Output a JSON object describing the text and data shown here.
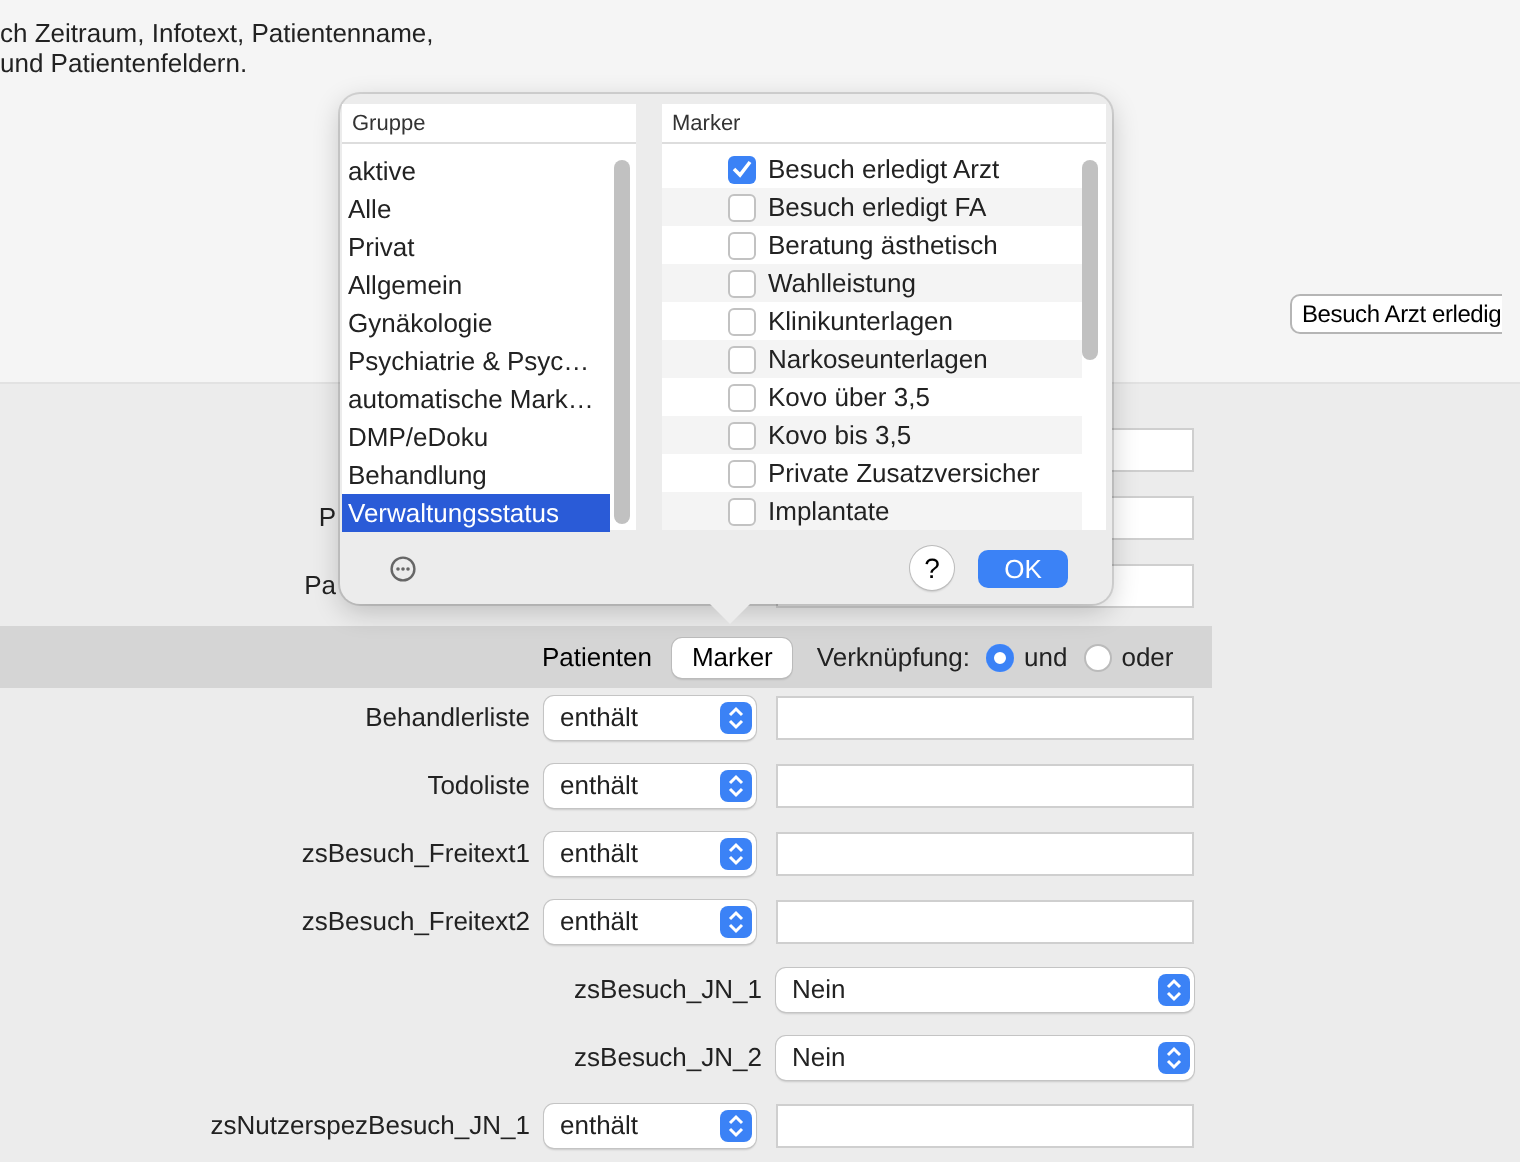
{
  "intro": {
    "lines": [
      "ch Zeitraum, Infotext, Patientenname,",
      "und Patientenfeldern."
    ]
  },
  "action_button": {
    "label": "Besuch Arzt erledig"
  },
  "hidden_rows": [
    {
      "label": ""
    },
    {
      "label": "P"
    },
    {
      "label": "Pa"
    }
  ],
  "filter_bar": {
    "tabs": [
      {
        "label": "Patienten",
        "selected": false
      },
      {
        "label": "Marker",
        "selected": true
      }
    ],
    "link_label": "Verknüpfung:",
    "options": [
      {
        "label": "und",
        "selected": true
      },
      {
        "label": "oder",
        "selected": false
      }
    ]
  },
  "fields": [
    {
      "kind": "text",
      "label": "Behandlerliste",
      "operator": "enthält"
    },
    {
      "kind": "text",
      "label": "Todoliste",
      "operator": "enthält"
    },
    {
      "kind": "text",
      "label": "zsBesuch_Freitext1",
      "operator": "enthält"
    },
    {
      "kind": "text",
      "label": "zsBesuch_Freitext2",
      "operator": "enthält"
    },
    {
      "kind": "yesno",
      "label": "zsBesuch_JN_1",
      "value": "Nein"
    },
    {
      "kind": "yesno",
      "label": "zsBesuch_JN_2",
      "value": "Nein"
    },
    {
      "kind": "text",
      "label": "zsNutzerspezBesuch_JN_1",
      "operator": "enthält"
    }
  ],
  "popover": {
    "groups_header": "Gruppe",
    "groups": [
      {
        "label": "aktive",
        "selected": false
      },
      {
        "label": "Alle",
        "selected": false
      },
      {
        "label": "Privat",
        "selected": false
      },
      {
        "label": "Allgemein",
        "selected": false
      },
      {
        "label": "Gynäkologie",
        "selected": false
      },
      {
        "label": "Psychiatrie & Psyc…",
        "selected": false
      },
      {
        "label": "automatische Mark…",
        "selected": false
      },
      {
        "label": "DMP/eDoku",
        "selected": false
      },
      {
        "label": "Behandlung",
        "selected": false
      },
      {
        "label": "Verwaltungsstatus",
        "selected": true
      }
    ],
    "markers_header": "Marker",
    "markers": [
      {
        "label": "Besuch erledigt Arzt",
        "checked": true
      },
      {
        "label": "Besuch erledigt FA",
        "checked": false
      },
      {
        "label": "Beratung ästhetisch",
        "checked": false
      },
      {
        "label": "Wahlleistung",
        "checked": false
      },
      {
        "label": "Klinikunterlagen",
        "checked": false
      },
      {
        "label": "Narkoseunterlagen",
        "checked": false
      },
      {
        "label": "Kovo über 3,5",
        "checked": false
      },
      {
        "label": "Kovo bis 3,5",
        "checked": false
      },
      {
        "label": "Private Zusatzversicher",
        "checked": false
      },
      {
        "label": "Implantate",
        "checked": false
      }
    ],
    "help_label": "?",
    "ok_label": "OK"
  }
}
